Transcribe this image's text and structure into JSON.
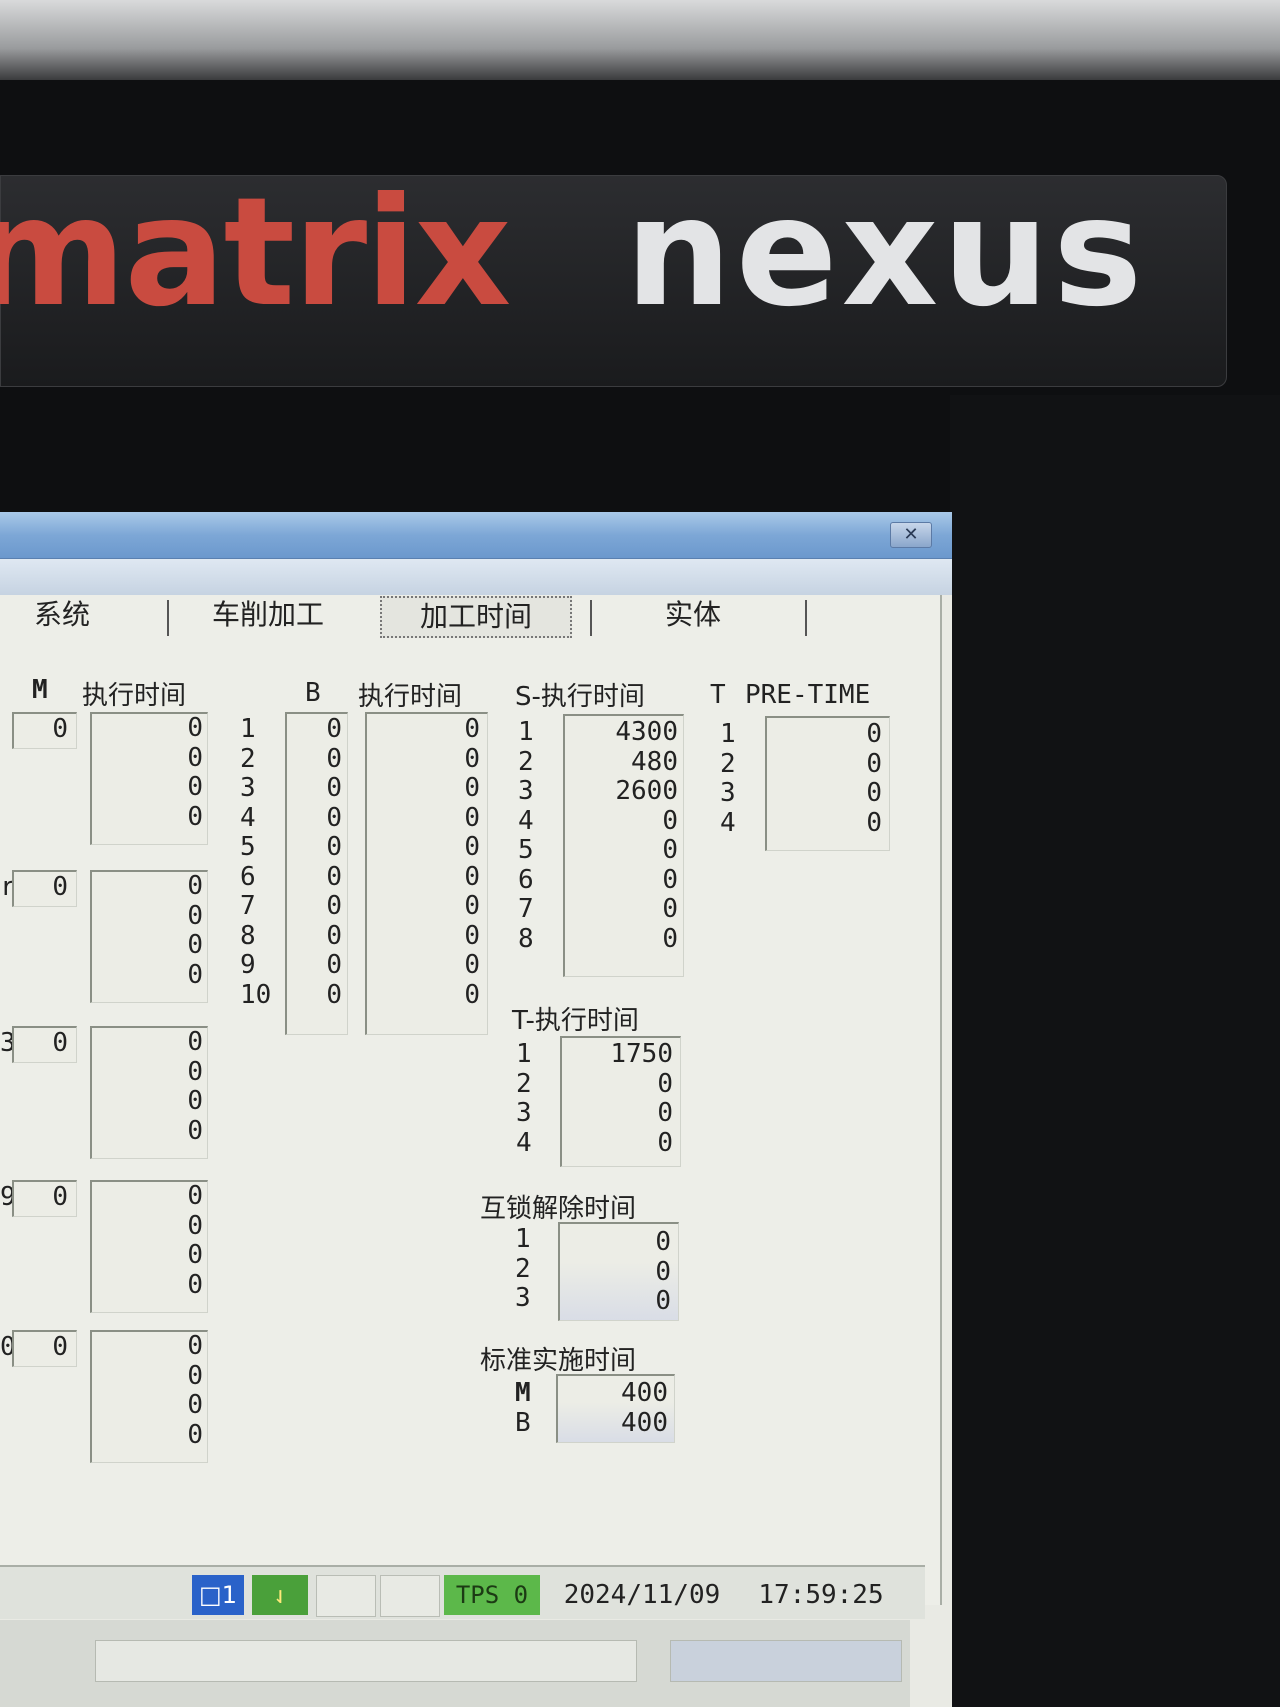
{
  "brand": {
    "part1": "matrix",
    "part2": "nexus"
  },
  "window": {
    "close_icon": "close-icon"
  },
  "tabs": [
    {
      "label": "系统"
    },
    {
      "label": "车削加工"
    },
    {
      "label": "加工时间"
    },
    {
      "label": "实体"
    }
  ],
  "m_group": {
    "header_m": "M",
    "header_exec": "执行时间",
    "blocks": [
      {
        "label": "",
        "value": "0",
        "times": [
          "0",
          "0",
          "0",
          "0"
        ]
      },
      {
        "label": "r",
        "value": "0",
        "times": [
          "0",
          "0",
          "0",
          "0"
        ]
      },
      {
        "label": "3",
        "value": "0",
        "times": [
          "0",
          "0",
          "0",
          "0"
        ]
      },
      {
        "label": "9",
        "value": "0",
        "times": [
          "0",
          "0",
          "0",
          "0"
        ]
      },
      {
        "label": "0",
        "value": "0",
        "times": [
          "0",
          "0",
          "0",
          "0"
        ]
      }
    ]
  },
  "b_group": {
    "header_b": "B",
    "header_exec": "执行时间",
    "indices": [
      "1",
      "2",
      "3",
      "4",
      "5",
      "6",
      "7",
      "8",
      "9",
      "10"
    ],
    "values": [
      "0",
      "0",
      "0",
      "0",
      "0",
      "0",
      "0",
      "0",
      "0",
      "0"
    ],
    "times": [
      "0",
      "0",
      "0",
      "0",
      "0",
      "0",
      "0",
      "0",
      "0",
      "0"
    ]
  },
  "s_group": {
    "header": "S-执行时间",
    "indices": [
      "1",
      "2",
      "3",
      "4",
      "5",
      "6",
      "7",
      "8"
    ],
    "values": [
      "4300",
      "480",
      "2600",
      "0",
      "0",
      "0",
      "0",
      "0"
    ]
  },
  "t_pre": {
    "header_t": "T",
    "header_pre": "PRE-TIME",
    "indices": [
      "1",
      "2",
      "3",
      "4"
    ],
    "values": [
      "0",
      "0",
      "0",
      "0"
    ]
  },
  "t_exec": {
    "header": "T-执行时间",
    "indices": [
      "1",
      "2",
      "3",
      "4"
    ],
    "values": [
      "1750",
      "0",
      "0",
      "0"
    ]
  },
  "interlock": {
    "header": "互锁解除时间",
    "indices": [
      "1",
      "2",
      "3"
    ],
    "values": [
      "0",
      "0",
      "0"
    ]
  },
  "standard": {
    "header": "标准实施时间",
    "rows": [
      {
        "label": "M",
        "value": "400"
      },
      {
        "label": "B",
        "value": "400"
      }
    ]
  },
  "statusbar": {
    "channel": "□1",
    "tps_label": "TPS",
    "tps_value": "0",
    "date": "2024/11/09",
    "time": "17:59:25"
  }
}
